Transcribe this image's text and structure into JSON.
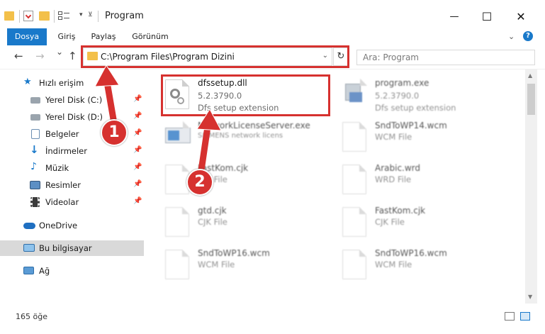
{
  "window": {
    "title": "Program",
    "minimize": "—",
    "maximize": "☐",
    "close": "✕"
  },
  "ribbon": {
    "tabs": [
      {
        "label": "Dosya",
        "active": true
      },
      {
        "label": "Giriş"
      },
      {
        "label": "Paylaş"
      },
      {
        "label": "Görünüm"
      }
    ],
    "help": "?"
  },
  "navigation": {
    "back": "←",
    "forward": "→",
    "recent": "⌄",
    "up": "↑",
    "address": "C:\\Program Files\\Program Dizini",
    "search_placeholder": "Ara: Program"
  },
  "sidebar": {
    "items": [
      {
        "label": "Hızlı erişim",
        "icon": "star-icon"
      },
      {
        "label": "Yerel Disk (C:)",
        "icon": "drive-icon",
        "pinned": true
      },
      {
        "label": "Yerel Disk (D:)",
        "icon": "drive-icon",
        "pinned": true
      },
      {
        "label": "Belgeler",
        "icon": "documents-icon",
        "pinned": true
      },
      {
        "label": "İndirmeler",
        "icon": "download-icon",
        "pinned": true
      },
      {
        "label": "Müzik",
        "icon": "music-icon",
        "pinned": true
      },
      {
        "label": "Resimler",
        "icon": "pictures-icon",
        "pinned": true
      },
      {
        "label": "Videolar",
        "icon": "videos-icon",
        "pinned": true
      },
      {
        "label": "OneDrive",
        "icon": "onedrive-icon"
      },
      {
        "label": "Bu bilgisayar",
        "icon": "computer-icon",
        "selected": true
      },
      {
        "label": "Ağ",
        "icon": "network-icon"
      }
    ]
  },
  "files": [
    {
      "name": "dfssetup.dll",
      "line1": "5.2.3790.0",
      "line2": "Dfs setup extension",
      "highlighted": true
    },
    {
      "name": "program.exe",
      "line1": "5.2.3790.0",
      "line2": "Dfs setup extension"
    },
    {
      "name": "NetworkLicenseServer.exe",
      "line1": "SIEMENS network licens"
    },
    {
      "name": "SndToWP14.wcm",
      "line1": "WCM File"
    },
    {
      "name": "FastKom.cjk",
      "line1": "CJK File"
    },
    {
      "name": "Arabic.wrd",
      "line1": "WRD File"
    },
    {
      "name": "gtd.cjk",
      "line1": "CJK File"
    },
    {
      "name": "FastKom.cjk",
      "line1": "CJK File"
    },
    {
      "name": "SndToWP16.wcm",
      "line1": "WCM File"
    },
    {
      "name": "SndToWP16.wcm",
      "line1": "WCM File"
    }
  ],
  "status": {
    "count": "165 öğe"
  },
  "callouts": [
    "1",
    "2"
  ],
  "colors": {
    "accent": "#1979ca",
    "highlight": "#d6312f",
    "folder": "#f3c04a"
  }
}
